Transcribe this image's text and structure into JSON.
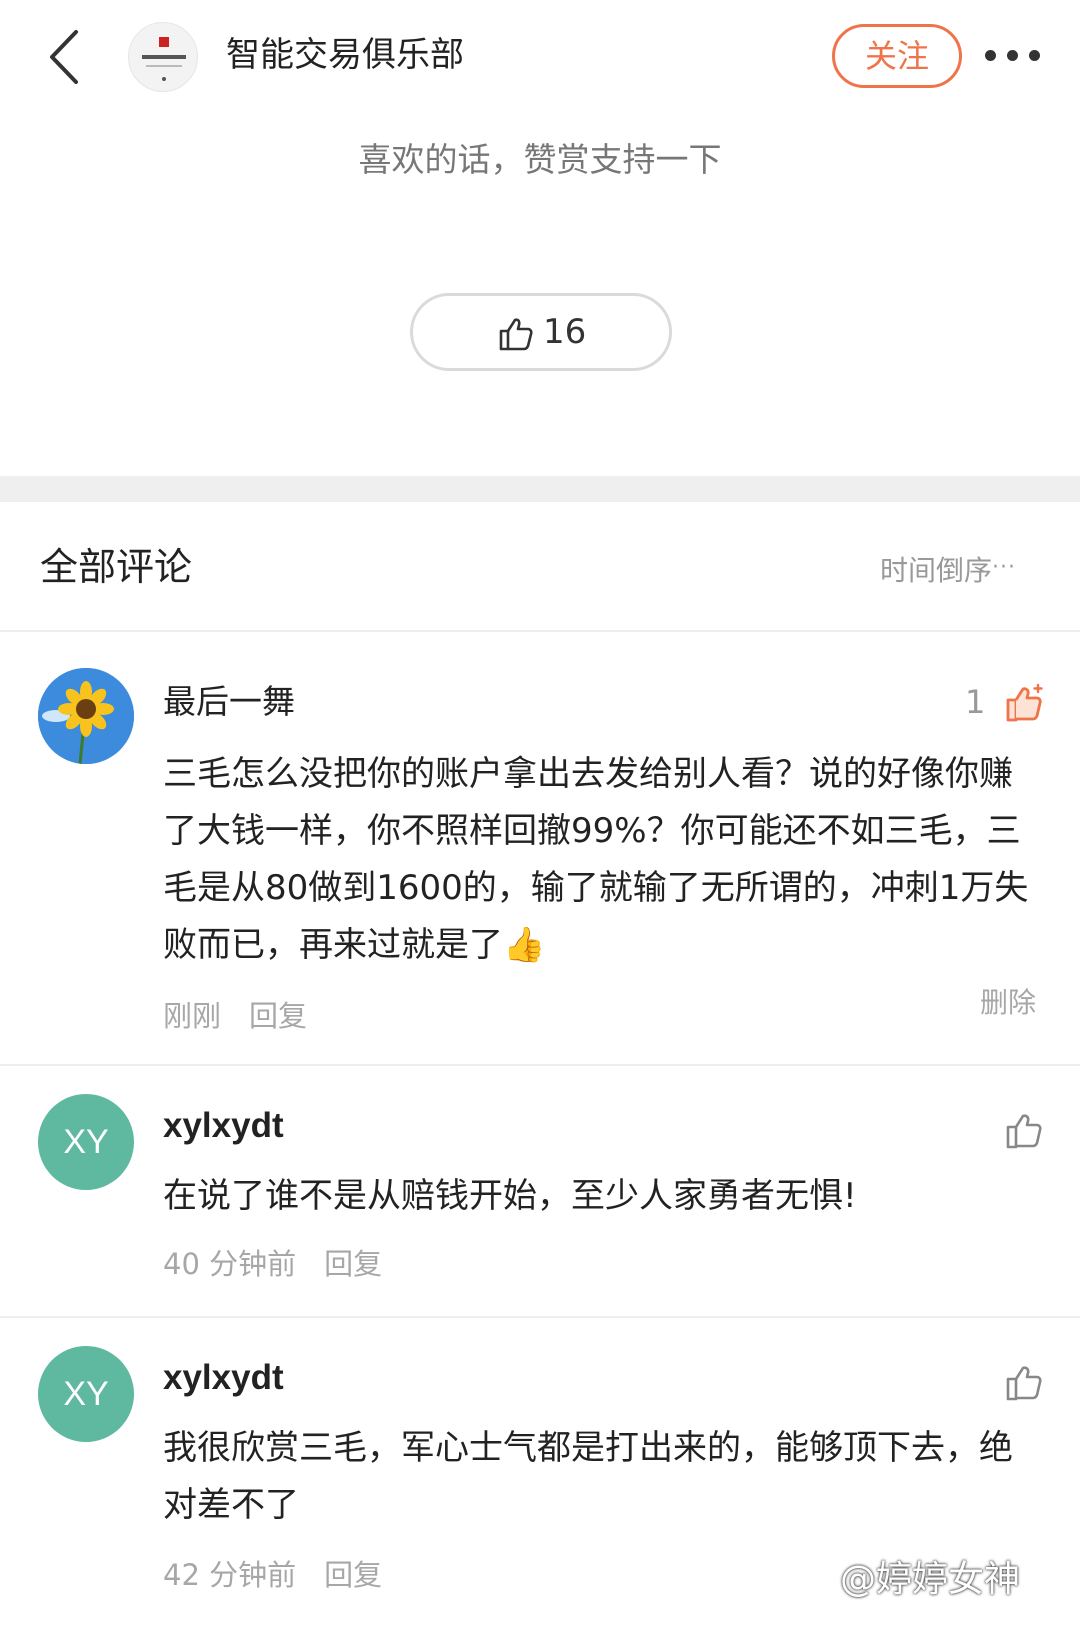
{
  "header": {
    "account_name": "智能交易俱乐部",
    "follow_label": "关注"
  },
  "reward": {
    "prompt": "喜欢的话，赞赏支持一下",
    "like_count": "16"
  },
  "comments_section": {
    "title": "全部评论",
    "sort_label": "时间倒序",
    "sort_more": "···"
  },
  "comments": [
    {
      "user": "最后一舞",
      "avatar": "sunflower",
      "text": "三毛怎么没把你的账户拿出去发给别人看？说的好像你赚了大钱一样，你不照样回撤99%？你可能还不如三毛，三毛是从80做到1600的，输了就输了无所谓的，冲刺1万失败而已，再来过就是了👍",
      "time": "刚刚",
      "reply_label": "回复",
      "delete_label": "删除",
      "likes": "1",
      "liked": true
    },
    {
      "user": "xylxydt",
      "avatar_initials": "XY",
      "text": "在说了谁不是从赔钱开始，至少人家勇者无惧!",
      "time": "40 分钟前",
      "reply_label": "回复"
    },
    {
      "user": "xylxydt",
      "avatar_initials": "XY",
      "text": "我很欣赏三毛，军心士气都是打出来的，能够顶下去，绝对差不了",
      "time": "42 分钟前",
      "reply_label": "回复"
    }
  ],
  "watermark": "@婷婷女神",
  "colors": {
    "accent": "#f0744a",
    "avatar_bg": "#5fb9a0",
    "muted": "#a7a7a7"
  }
}
